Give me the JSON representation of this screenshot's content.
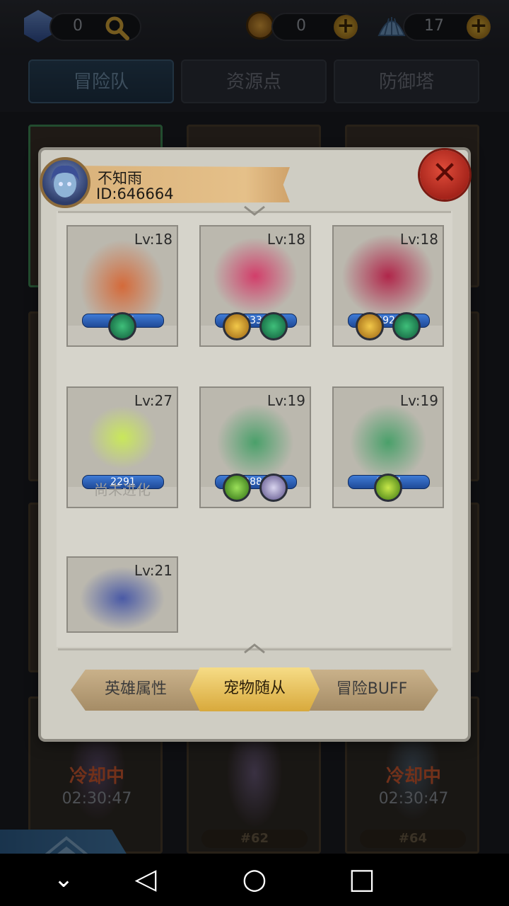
{
  "top": {
    "gem_count": "0",
    "coin_count": "0",
    "shell_count": "17",
    "plus_label": "+"
  },
  "tabs": [
    {
      "label": "冒险队",
      "active": true
    },
    {
      "label": "资源点",
      "active": false
    },
    {
      "label": "防御塔",
      "active": false
    }
  ],
  "background_slots": [
    {
      "status": "冷却中",
      "timer": "02:30:47",
      "slot": ""
    },
    {
      "status": "",
      "timer": "",
      "slot": "#62"
    },
    {
      "status": "冷却中",
      "timer": "02:30:47",
      "slot": "#64"
    }
  ],
  "modal": {
    "player_name": "不知雨",
    "player_id": "ID:646664",
    "close_label": "✕",
    "pets": [
      {
        "level": "Lv:18",
        "power": "2231",
        "badges": [
          "green-feather"
        ],
        "art": "dwarf"
      },
      {
        "level": "Lv:18",
        "power": "2330",
        "badges": [
          "gold-hammer",
          "green-feather"
        ],
        "art": "sorceress"
      },
      {
        "level": "Lv:18",
        "power": "2928",
        "badges": [
          "gold-hammer",
          "green-feather"
        ],
        "art": "beetle"
      },
      {
        "level": "Lv:27",
        "power": "2291",
        "badges": [],
        "evolve_text": "尚未进化",
        "art": "flag"
      },
      {
        "level": "Lv:19",
        "power": "2884",
        "badges": [
          "green-cross",
          "purple-crown"
        ],
        "art": "goblin"
      },
      {
        "level": "Lv:19",
        "power": "3374",
        "badges": [
          "green-amulet"
        ],
        "art": "goblin"
      },
      {
        "level": "Lv:21",
        "power": "",
        "badges": [],
        "art": "serpent"
      }
    ],
    "bottom_tabs": [
      {
        "label": "英雄属性",
        "active": false
      },
      {
        "label": "宠物随从",
        "active": true
      },
      {
        "label": "冒险BUFF",
        "active": false
      }
    ]
  },
  "nav": {
    "back": "◁",
    "home": "○",
    "recent": "□",
    "down": "⌄"
  },
  "colors": {
    "accent_gold": "#e3b94a",
    "power_bar": "#2f66c4",
    "close_red": "#c3352a",
    "cooldown": "#cf5a31"
  }
}
